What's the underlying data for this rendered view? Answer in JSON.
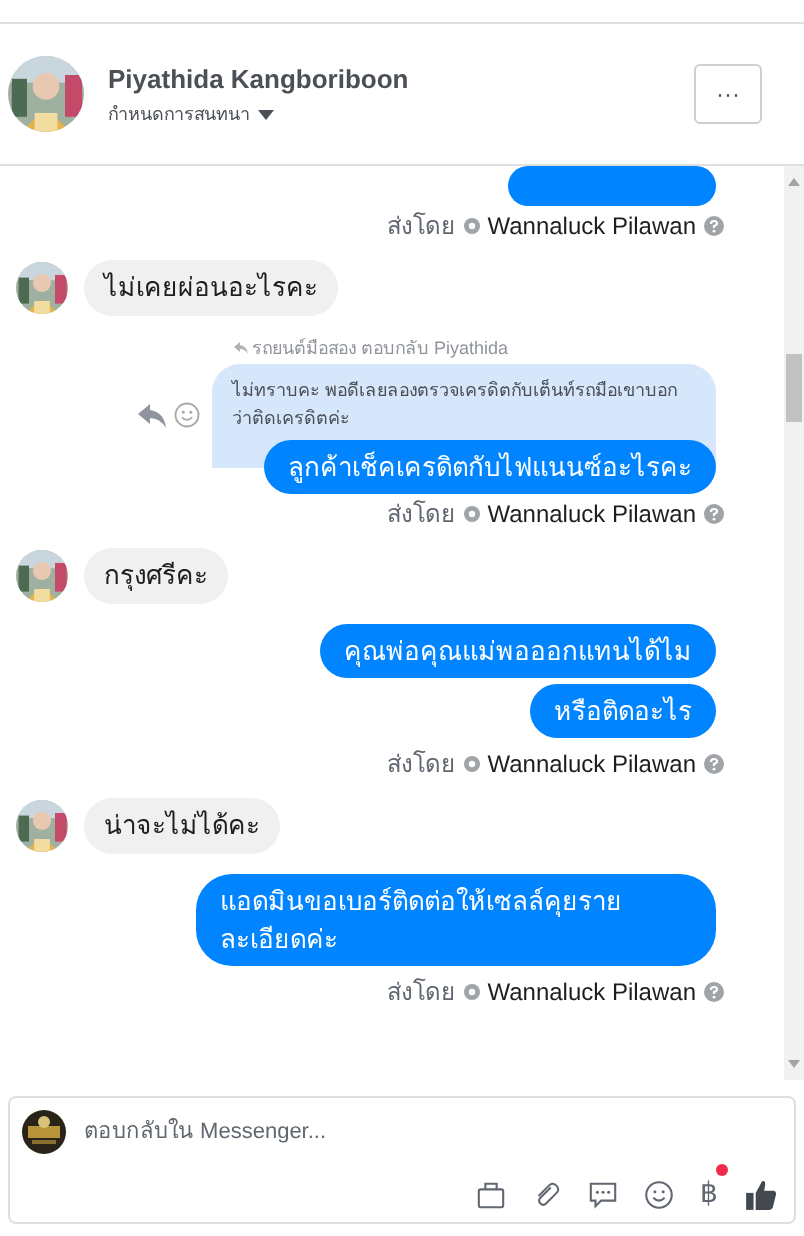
{
  "header": {
    "name": "Piyathida Kangboriboon",
    "subtitle": "กำหนดการสนทนา",
    "more_button": "···"
  },
  "messages": [
    {
      "kind": "cut"
    },
    {
      "kind": "sent_by",
      "prefix": "ส่งโดย",
      "sender": "Wannaluck Pilawan"
    },
    {
      "kind": "incoming",
      "text": "ไม่เคยผ่อนอะไรคะ"
    },
    {
      "kind": "reply",
      "label": "รถยนต์มือสอง ตอบกลับ Piyathida",
      "quote": "ไม่ทราบคะ พอดีเลยลองตรวจเครดิตกับเต็นท์รถมือเขาบอกว่าติดเครดิตค่ะ",
      "text": "ลูกค้าเช็คเครดิตกับไฟแนนซ์อะไรคะ"
    },
    {
      "kind": "sent_by",
      "prefix": "ส่งโดย",
      "sender": "Wannaluck Pilawan"
    },
    {
      "kind": "incoming",
      "text": "กรุงศรีคะ"
    },
    {
      "kind": "outgoing",
      "text": "คุณพ่อคุณแม่พอออกแทนได้ไม"
    },
    {
      "kind": "outgoing",
      "text": "หรือติดอะไร"
    },
    {
      "kind": "sent_by",
      "prefix": "ส่งโดย",
      "sender": "Wannaluck Pilawan"
    },
    {
      "kind": "incoming",
      "text": "น่าจะไม่ได้คะ"
    },
    {
      "kind": "outgoing",
      "text": "แอดมินขอเบอร์ติดต่อให้เซลล์คุยรายละเอียดค่ะ"
    },
    {
      "kind": "sent_by",
      "prefix": "ส่งโดย",
      "sender": "Wannaluck Pilawan"
    }
  ],
  "composer": {
    "placeholder": "ตอบกลับใน Messenger...",
    "currency_symbol": "฿",
    "currency_badge": true
  }
}
